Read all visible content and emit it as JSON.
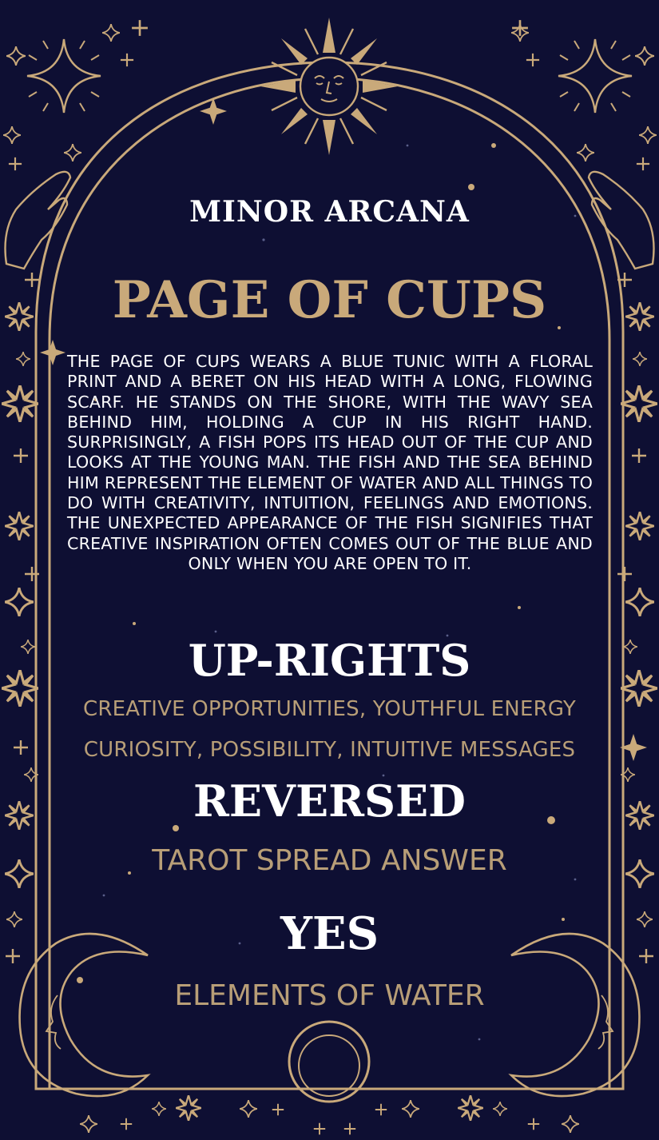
{
  "card": {
    "subtitle": "MINOR ARCANA",
    "title": "PAGE OF CUPS",
    "description": "THE PAGE OF CUPS WEARS A BLUE TUNIC WITH A FLORAL PRINT AND A BERET ON HIS HEAD WITH A LONG, FLOWING SCARF. HE STANDS ON THE SHORE, WITH THE WAVY SEA BEHIND HIM, HOLDING A CUP IN HIS RIGHT HAND. SURPRISINGLY, A FISH POPS ITS HEAD OUT OF THE CUP AND LOOKS AT THE YOUNG MAN. THE FISH AND THE SEA BEHIND HIM REPRESENT THE ELEMENT OF WATER AND ALL THINGS TO DO WITH CREATIVITY, INTUITION, FEELINGS AND EMOTIONS. THE UNEXPECTED APPEARANCE OF THE FISH SIGNIFIES THAT CREATIVE INSPIRATION OFTEN COMES OUT OF THE BLUE AND ONLY WHEN YOU ARE OPEN TO IT.",
    "uprights_heading": "UP-RIGHTS",
    "uprights_line1": "CREATIVE OPPORTUNITIES, YOUTHFUL ENERGY",
    "uprights_line2": "CURIOSITY, POSSIBILITY, INTUITIVE MESSAGES",
    "reversed_heading": "REVERSED",
    "spread_label": "TAROT SPREAD ANSWER",
    "answer": "YES",
    "element": "ELEMENTS OF WATER"
  },
  "colors": {
    "background": "#0e0f33",
    "gold": "#c9a97a",
    "text": "#ffffff"
  },
  "icons": [
    "sun-face-icon",
    "sparkle-star-icon",
    "praying-hands-icon",
    "crescent-moon-face-icon",
    "circle-icon",
    "dot-star-icon"
  ]
}
